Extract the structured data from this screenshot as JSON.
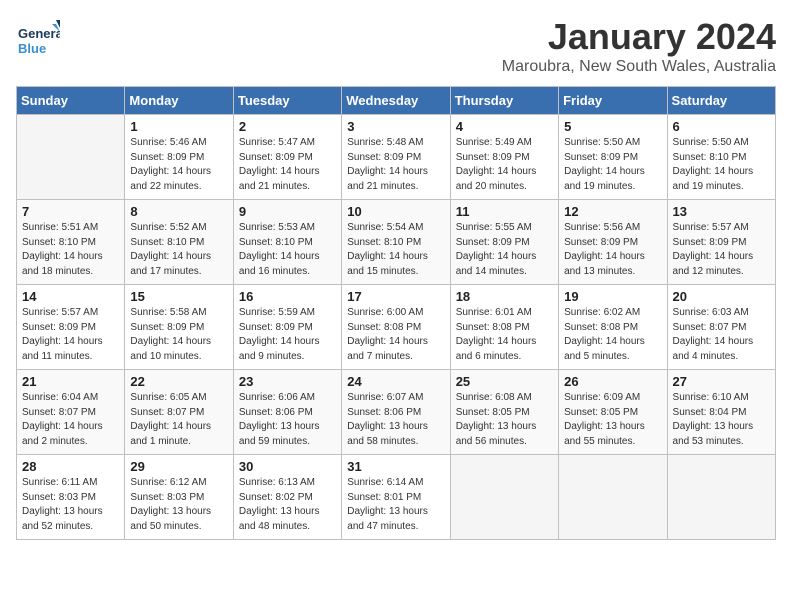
{
  "logo": {
    "general": "General",
    "blue": "Blue"
  },
  "title": "January 2024",
  "location": "Maroubra, New South Wales, Australia",
  "days_of_week": [
    "Sunday",
    "Monday",
    "Tuesday",
    "Wednesday",
    "Thursday",
    "Friday",
    "Saturday"
  ],
  "weeks": [
    [
      {
        "day": "",
        "info": ""
      },
      {
        "day": "1",
        "info": "Sunrise: 5:46 AM\nSunset: 8:09 PM\nDaylight: 14 hours\nand 22 minutes."
      },
      {
        "day": "2",
        "info": "Sunrise: 5:47 AM\nSunset: 8:09 PM\nDaylight: 14 hours\nand 21 minutes."
      },
      {
        "day": "3",
        "info": "Sunrise: 5:48 AM\nSunset: 8:09 PM\nDaylight: 14 hours\nand 21 minutes."
      },
      {
        "day": "4",
        "info": "Sunrise: 5:49 AM\nSunset: 8:09 PM\nDaylight: 14 hours\nand 20 minutes."
      },
      {
        "day": "5",
        "info": "Sunrise: 5:50 AM\nSunset: 8:09 PM\nDaylight: 14 hours\nand 19 minutes."
      },
      {
        "day": "6",
        "info": "Sunrise: 5:50 AM\nSunset: 8:10 PM\nDaylight: 14 hours\nand 19 minutes."
      }
    ],
    [
      {
        "day": "7",
        "info": "Sunrise: 5:51 AM\nSunset: 8:10 PM\nDaylight: 14 hours\nand 18 minutes."
      },
      {
        "day": "8",
        "info": "Sunrise: 5:52 AM\nSunset: 8:10 PM\nDaylight: 14 hours\nand 17 minutes."
      },
      {
        "day": "9",
        "info": "Sunrise: 5:53 AM\nSunset: 8:10 PM\nDaylight: 14 hours\nand 16 minutes."
      },
      {
        "day": "10",
        "info": "Sunrise: 5:54 AM\nSunset: 8:10 PM\nDaylight: 14 hours\nand 15 minutes."
      },
      {
        "day": "11",
        "info": "Sunrise: 5:55 AM\nSunset: 8:09 PM\nDaylight: 14 hours\nand 14 minutes."
      },
      {
        "day": "12",
        "info": "Sunrise: 5:56 AM\nSunset: 8:09 PM\nDaylight: 14 hours\nand 13 minutes."
      },
      {
        "day": "13",
        "info": "Sunrise: 5:57 AM\nSunset: 8:09 PM\nDaylight: 14 hours\nand 12 minutes."
      }
    ],
    [
      {
        "day": "14",
        "info": "Sunrise: 5:57 AM\nSunset: 8:09 PM\nDaylight: 14 hours\nand 11 minutes."
      },
      {
        "day": "15",
        "info": "Sunrise: 5:58 AM\nSunset: 8:09 PM\nDaylight: 14 hours\nand 10 minutes."
      },
      {
        "day": "16",
        "info": "Sunrise: 5:59 AM\nSunset: 8:09 PM\nDaylight: 14 hours\nand 9 minutes."
      },
      {
        "day": "17",
        "info": "Sunrise: 6:00 AM\nSunset: 8:08 PM\nDaylight: 14 hours\nand 7 minutes."
      },
      {
        "day": "18",
        "info": "Sunrise: 6:01 AM\nSunset: 8:08 PM\nDaylight: 14 hours\nand 6 minutes."
      },
      {
        "day": "19",
        "info": "Sunrise: 6:02 AM\nSunset: 8:08 PM\nDaylight: 14 hours\nand 5 minutes."
      },
      {
        "day": "20",
        "info": "Sunrise: 6:03 AM\nSunset: 8:07 PM\nDaylight: 14 hours\nand 4 minutes."
      }
    ],
    [
      {
        "day": "21",
        "info": "Sunrise: 6:04 AM\nSunset: 8:07 PM\nDaylight: 14 hours\nand 2 minutes."
      },
      {
        "day": "22",
        "info": "Sunrise: 6:05 AM\nSunset: 8:07 PM\nDaylight: 14 hours\nand 1 minute."
      },
      {
        "day": "23",
        "info": "Sunrise: 6:06 AM\nSunset: 8:06 PM\nDaylight: 13 hours\nand 59 minutes."
      },
      {
        "day": "24",
        "info": "Sunrise: 6:07 AM\nSunset: 8:06 PM\nDaylight: 13 hours\nand 58 minutes."
      },
      {
        "day": "25",
        "info": "Sunrise: 6:08 AM\nSunset: 8:05 PM\nDaylight: 13 hours\nand 56 minutes."
      },
      {
        "day": "26",
        "info": "Sunrise: 6:09 AM\nSunset: 8:05 PM\nDaylight: 13 hours\nand 55 minutes."
      },
      {
        "day": "27",
        "info": "Sunrise: 6:10 AM\nSunset: 8:04 PM\nDaylight: 13 hours\nand 53 minutes."
      }
    ],
    [
      {
        "day": "28",
        "info": "Sunrise: 6:11 AM\nSunset: 8:03 PM\nDaylight: 13 hours\nand 52 minutes."
      },
      {
        "day": "29",
        "info": "Sunrise: 6:12 AM\nSunset: 8:03 PM\nDaylight: 13 hours\nand 50 minutes."
      },
      {
        "day": "30",
        "info": "Sunrise: 6:13 AM\nSunset: 8:02 PM\nDaylight: 13 hours\nand 48 minutes."
      },
      {
        "day": "31",
        "info": "Sunrise: 6:14 AM\nSunset: 8:01 PM\nDaylight: 13 hours\nand 47 minutes."
      },
      {
        "day": "",
        "info": ""
      },
      {
        "day": "",
        "info": ""
      },
      {
        "day": "",
        "info": ""
      }
    ]
  ]
}
